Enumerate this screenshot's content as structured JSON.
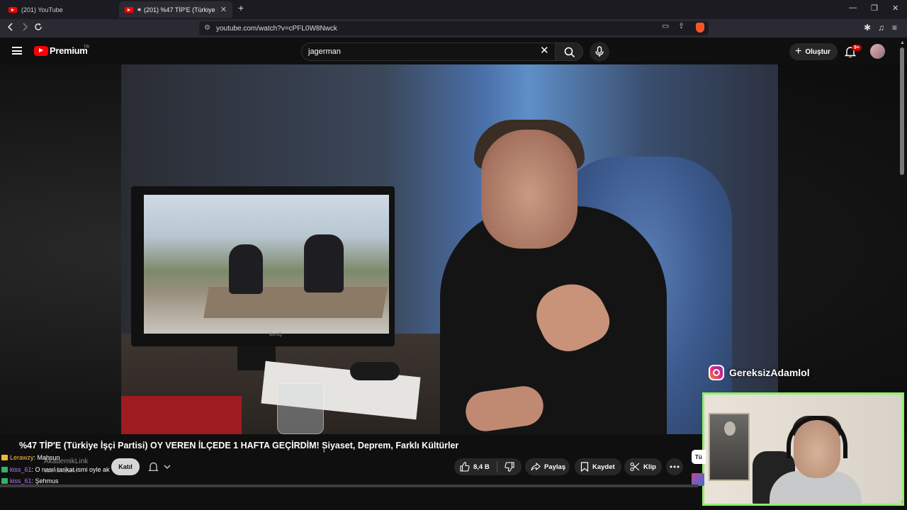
{
  "browser": {
    "tabs": [
      {
        "label": "(201) YouTube"
      },
      {
        "label": "(201) %47 TİP'E (Türkiye İşçi P"
      }
    ],
    "url": "youtube.com/watch?v=cPFL0W8Nwck"
  },
  "youtube": {
    "logo_text": "Premium",
    "logo_region": "TR",
    "search_value": "jagerman",
    "create_label": "Oluştur",
    "notifications_badge": "9+"
  },
  "video": {
    "title": "%47 TİP'E (Türkiye İşçi Partisi) OY VEREN İLÇEDE 1 HAFTA GEÇİRDİM! Siyaset, Deprem, Farklı Kültürler",
    "monitor_brand": "BenQ",
    "watermark": "GereksizAdamlol",
    "channel_name": "AkademikLink",
    "subscribers": "1,26 Mn abone",
    "join_label": "Katıl",
    "likes": "8,4 B",
    "share_label": "Paylaş",
    "save_label": "Kaydet",
    "clip_label": "Klip",
    "side_tag": "Tü"
  },
  "chat": [
    {
      "user": "Lerawzy",
      "message": ": Mahsun"
    },
    {
      "user": "kiss_61",
      "message": ": O nasıl tarikat ismi oyle ak"
    },
    {
      "user": "kiss_61",
      "message": ": Şehmus"
    }
  ],
  "colors": {
    "youtube_red": "#ff0000",
    "webcam_border": "#8ef06b",
    "badge_red": "#cc0000"
  }
}
